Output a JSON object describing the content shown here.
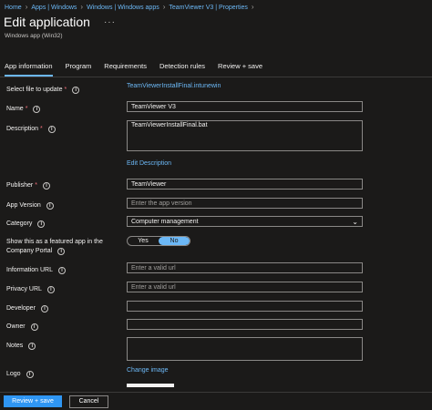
{
  "breadcrumb": [
    {
      "label": "Home"
    },
    {
      "label": "Apps | Windows"
    },
    {
      "label": "Windows | Windows apps"
    },
    {
      "label": "TeamViewer V3 | Properties"
    }
  ],
  "header": {
    "title": "Edit application",
    "more": "···",
    "subtitle": "Windows app (Win32)"
  },
  "tabs": [
    "App information",
    "Program",
    "Requirements",
    "Detection rules",
    "Review + save"
  ],
  "form": {
    "file": {
      "label": "Select file to update",
      "value": "TeamViewerInstallFinal.intunewin"
    },
    "name": {
      "label": "Name",
      "value": "TeamViewer V3"
    },
    "description": {
      "label": "Description",
      "value": "TeamViewerInstallFinal.bat",
      "link": "Edit Description"
    },
    "publisher": {
      "label": "Publisher",
      "value": "TeamViewer"
    },
    "app_version": {
      "label": "App Version",
      "placeholder": "Enter the app version"
    },
    "category": {
      "label": "Category",
      "value": "Computer management"
    },
    "featured": {
      "label_line1": "Show this as a featured app in the",
      "label_line2": "Company Portal",
      "yes": "Yes",
      "no": "No",
      "selected": "No"
    },
    "information_url": {
      "label": "Information URL",
      "placeholder": "Enter a valid url"
    },
    "privacy_url": {
      "label": "Privacy URL",
      "placeholder": "Enter a valid url"
    },
    "developer": {
      "label": "Developer",
      "value": ""
    },
    "owner": {
      "label": "Owner",
      "value": ""
    },
    "notes": {
      "label": "Notes",
      "value": ""
    },
    "logo": {
      "label": "Logo",
      "link": "Change image"
    }
  },
  "footer": {
    "review_save": "Review + save",
    "cancel": "Cancel"
  },
  "colors": {
    "accent": "#2f96f3",
    "link": "#6cb8f6",
    "background": "#1b1a19",
    "required": "#f1707b"
  }
}
